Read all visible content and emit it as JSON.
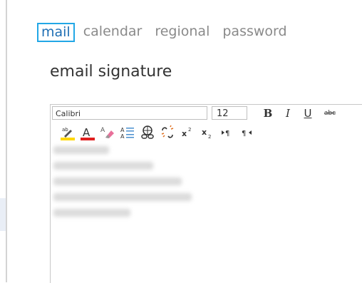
{
  "nav": {
    "tabs": [
      {
        "label": "mail",
        "active": true
      },
      {
        "label": "calendar",
        "active": false
      },
      {
        "label": "regional",
        "active": false
      },
      {
        "label": "password",
        "active": false
      }
    ]
  },
  "page": {
    "title": "email signature"
  },
  "editor": {
    "font_name": "Calibri",
    "font_size": "12",
    "format_buttons": {
      "bold": "B",
      "italic": "I",
      "underline": "U",
      "strikethrough": "abc"
    },
    "toolbar_icons": [
      "highlight-icon",
      "font-color-icon",
      "clear-formatting-icon",
      "align-icon",
      "insert-link-icon",
      "remove-link-icon",
      "superscript-icon",
      "subscript-icon",
      "ltr-icon",
      "rtl-icon"
    ],
    "colors": {
      "highlight": "#ffd700",
      "font_color": "#e02020",
      "accent": "#22a7e6"
    }
  }
}
